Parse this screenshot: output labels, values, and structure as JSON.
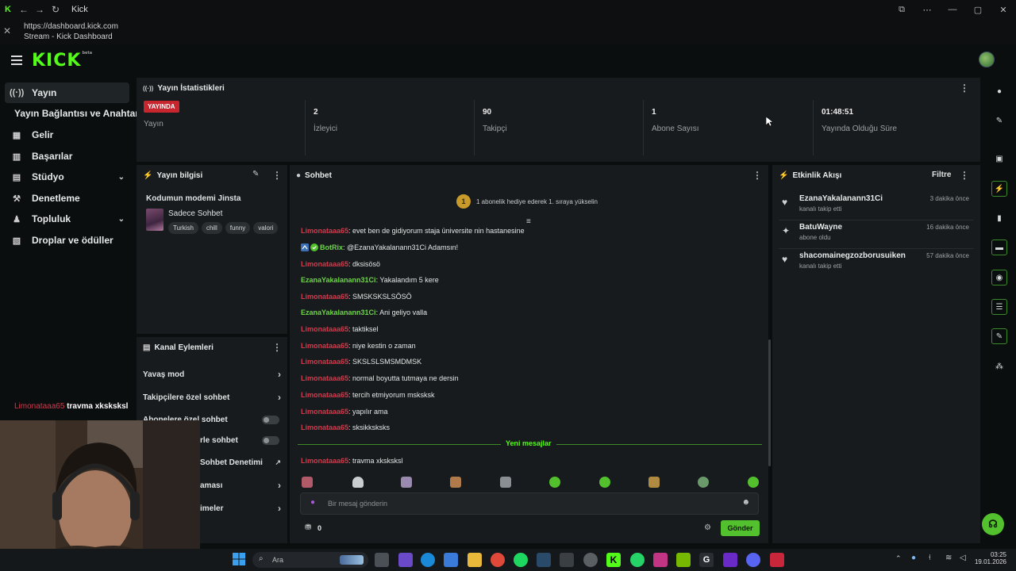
{
  "browser": {
    "title": "Kick",
    "url": "https://dashboard.kick.com",
    "page_title": "Stream - Kick Dashboard"
  },
  "app": {
    "logo": "KICK",
    "logo_tag": "beta",
    "accent": "#53fc18"
  },
  "nav": {
    "items": [
      {
        "label": "Yayın",
        "icon": "broadcast-icon"
      },
      {
        "label": "Yayın Bağlantısı ve Anahtarı"
      },
      {
        "label": "Gelir",
        "icon": "revenue-icon"
      },
      {
        "label": "Başarılar",
        "icon": "achievements-icon"
      },
      {
        "label": "Stüdyo",
        "icon": "studio-icon"
      },
      {
        "label": "Denetleme",
        "icon": "moderation-icon"
      },
      {
        "label": "Topluluk",
        "icon": "community-icon"
      },
      {
        "label": "Droplar ve ödüller",
        "icon": "drops-icon"
      }
    ]
  },
  "stats": {
    "title": "Yayın İstatistikleri",
    "live_badge": "YAYINDA",
    "live_label": "Yayın",
    "viewers_value": "2",
    "viewers_label": "İzleyici",
    "followers_value": "90",
    "followers_label": "Takipçi",
    "subs_value": "1",
    "subs_label": "Abone Sayısı",
    "uptime_value": "01:48:51",
    "uptime_label": "Yayında Olduğu Süre"
  },
  "stream_info": {
    "title": "Yayın bilgisi",
    "stream_title": "Kodumun modemi Jinsta",
    "category": "Sadece Sohbet",
    "tags": [
      "Turkish",
      "chill",
      "funny",
      "valori"
    ]
  },
  "channel_actions": {
    "title": "Kanal Eylemleri",
    "rows": [
      "Yavaş mod",
      "Takipçilere özel sohbet",
      "Abonelere özel sohbet",
      "rle sohbet",
      "Sohbet Denetimi",
      "aması",
      "imeler"
    ]
  },
  "chat": {
    "title": "Sohbet",
    "pinned": "1 abonelik hediye ederek 1. sıraya yükselin",
    "pinned_rank": "1",
    "messages": [
      {
        "user": "Limonataaa65",
        "text": "evet ben de gidiyorum staja üniversite nin hastanesine"
      },
      {
        "user": "BotRix",
        "text": "@EzanaYakalanann31Ci Adamsın!"
      },
      {
        "user": "Limonataaa65",
        "text": "dksisösö"
      },
      {
        "user": "EzanaYakalanann31Ci",
        "text": "Yakalandım 5 kere"
      },
      {
        "user": "Limonataaa65",
        "text": "SMSKSKSLSÖSÖ"
      },
      {
        "user": "EzanaYakalanann31Ci",
        "text": "Ani geliyo valla"
      },
      {
        "user": "Limonataaa65",
        "text": "taktiksel"
      },
      {
        "user": "Limonataaa65",
        "text": "niye kestin o zaman"
      },
      {
        "user": "Limonataaa65",
        "text": "SKSLSLSMSMDMSK"
      },
      {
        "user": "Limonataaa65",
        "text": "normal boyutta tutmaya ne dersin"
      },
      {
        "user": "Limonataaa65",
        "text": "tercih etmiyorum msksksk"
      },
      {
        "user": "Limonataaa65",
        "text": "yapılır ama"
      },
      {
        "user": "Limonataaa65",
        "text": "sksikksksks"
      },
      {
        "user": "Limonataaa65",
        "text": "travma xksksksl"
      }
    ],
    "new_messages": "Yeni mesajlar",
    "input_placeholder": "Bir mesaj gönderin",
    "points": "0",
    "send_label": "Gönder"
  },
  "activity": {
    "title": "Etkinlik Akışı",
    "filter": "Filtre",
    "events": [
      {
        "name": "EzanaYakalanann31Ci",
        "desc": "kanalı takip etti",
        "time": "3 dakika önce"
      },
      {
        "name": "BatuWayne",
        "desc": "abone oldu",
        "time": "16 dakika önce"
      },
      {
        "name": "shacomainegzozborusuiken",
        "desc": "kanalı takip etti",
        "time": "57 dakika önce"
      }
    ]
  },
  "overlay": {
    "user": "Limonataaa65",
    "text": "travma xksksksl"
  },
  "taskbar": {
    "search": "Ara",
    "time": "03:25",
    "date": "19.01.2026"
  }
}
